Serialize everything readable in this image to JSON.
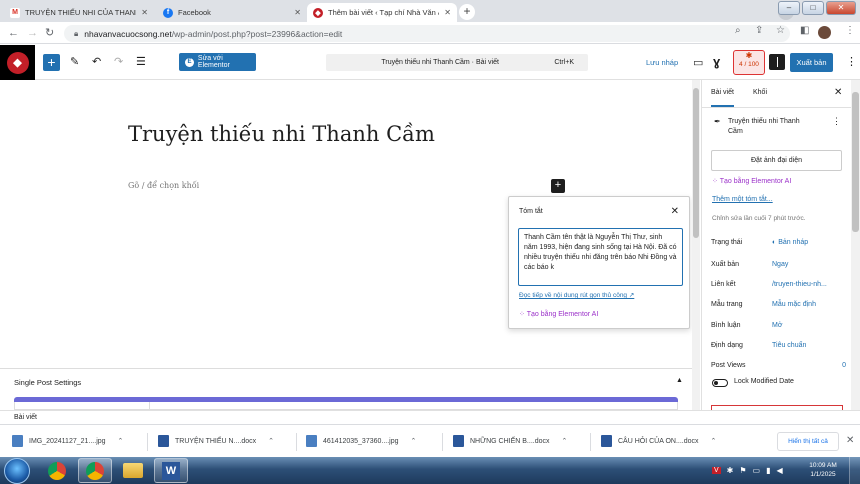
{
  "browser": {
    "tabs": [
      {
        "title": "TRUYỆN THIẾU NHI CỦA THANH CẦ",
        "icon": "gmail-icon"
      },
      {
        "title": "Facebook",
        "icon": "facebook-icon"
      },
      {
        "title": "Thêm bài viết ‹ Tạp chí Nhà Văn & C",
        "icon": "site-icon",
        "active": true
      }
    ],
    "url_host": "nhavanvacuocsong.net",
    "url_path": "/wp-admin/post.php?post=23996&action=edit"
  },
  "toolbar": {
    "elementor_label": "Sửa với Elementor",
    "command_title": "Truyện thiếu nhi Thanh Cầm · Bài viết",
    "command_shortcut": "Ctrl+K",
    "save_draft": "Lưu nháp",
    "seo_score": "4 / 100",
    "publish": "Xuất bản"
  },
  "editor": {
    "title": "Truyện thiếu nhi Thanh Cầm",
    "placeholder": "Gõ / để chọn khối"
  },
  "excerpt_popover": {
    "heading": "Tóm tắt",
    "text": "Thanh Cầm tên thật là Nguyễn Thị Thư, sinh năm 1993, hiện đang sinh sống tại Hà Nội. Đã có nhiều truyện thiếu nhi đăng trên báo Nhi Đồng và các báo k",
    "link": "Đọc tiếp về nội dung rút gọn thủ công ↗",
    "ai": "Tạo bằng Elementor AI"
  },
  "sidebar": {
    "tabs": [
      "Bài viết",
      "Khối"
    ],
    "post_title": "Truyện thiếu nhi Thanh Cầm",
    "featured_image": "Đặt ảnh đại diện",
    "ai": "Tạo bằng Elementor AI",
    "add_excerpt": "Thêm một tóm tắt...",
    "last_edited": "Chỉnh sửa lần cuối 7 phút trước.",
    "rows": [
      {
        "key": "Trạng thái",
        "value": "Bản nháp"
      },
      {
        "key": "Xuất bản",
        "value": "Ngay"
      },
      {
        "key": "Liên kết",
        "value": "/truyen-thieu-nh..."
      },
      {
        "key": "Mẫu trang",
        "value": "Mẫu mặc định"
      },
      {
        "key": "Bình luận",
        "value": "Mở"
      },
      {
        "key": "Định dạng",
        "value": "Tiêu chuẩn"
      }
    ],
    "post_views_label": "Post Views",
    "post_views_value": "0",
    "lock_label": "Lock Modified Date"
  },
  "single_post_settings": "Single Post Settings",
  "breadcrumb": "Bài viết",
  "downloads": [
    {
      "name": "IMG_20241127_21....jpg",
      "type": "image"
    },
    {
      "name": "TRUYỆN THIẾU N....docx",
      "type": "word"
    },
    {
      "name": "461412035_37360....jpg",
      "type": "image"
    },
    {
      "name": "NHỮNG CHIẾN B....docx",
      "type": "word"
    },
    {
      "name": "CÂU HỎI CỦA ON....docx",
      "type": "word"
    }
  ],
  "downloads_show_all": "Hiển thị tất cả",
  "clock": {
    "time": "10:09 AM",
    "date": "1/1/2025"
  },
  "colors": {
    "accent": "#2271b1",
    "ai": "#9b31c9",
    "elementor_bar": "#6b69d6"
  }
}
